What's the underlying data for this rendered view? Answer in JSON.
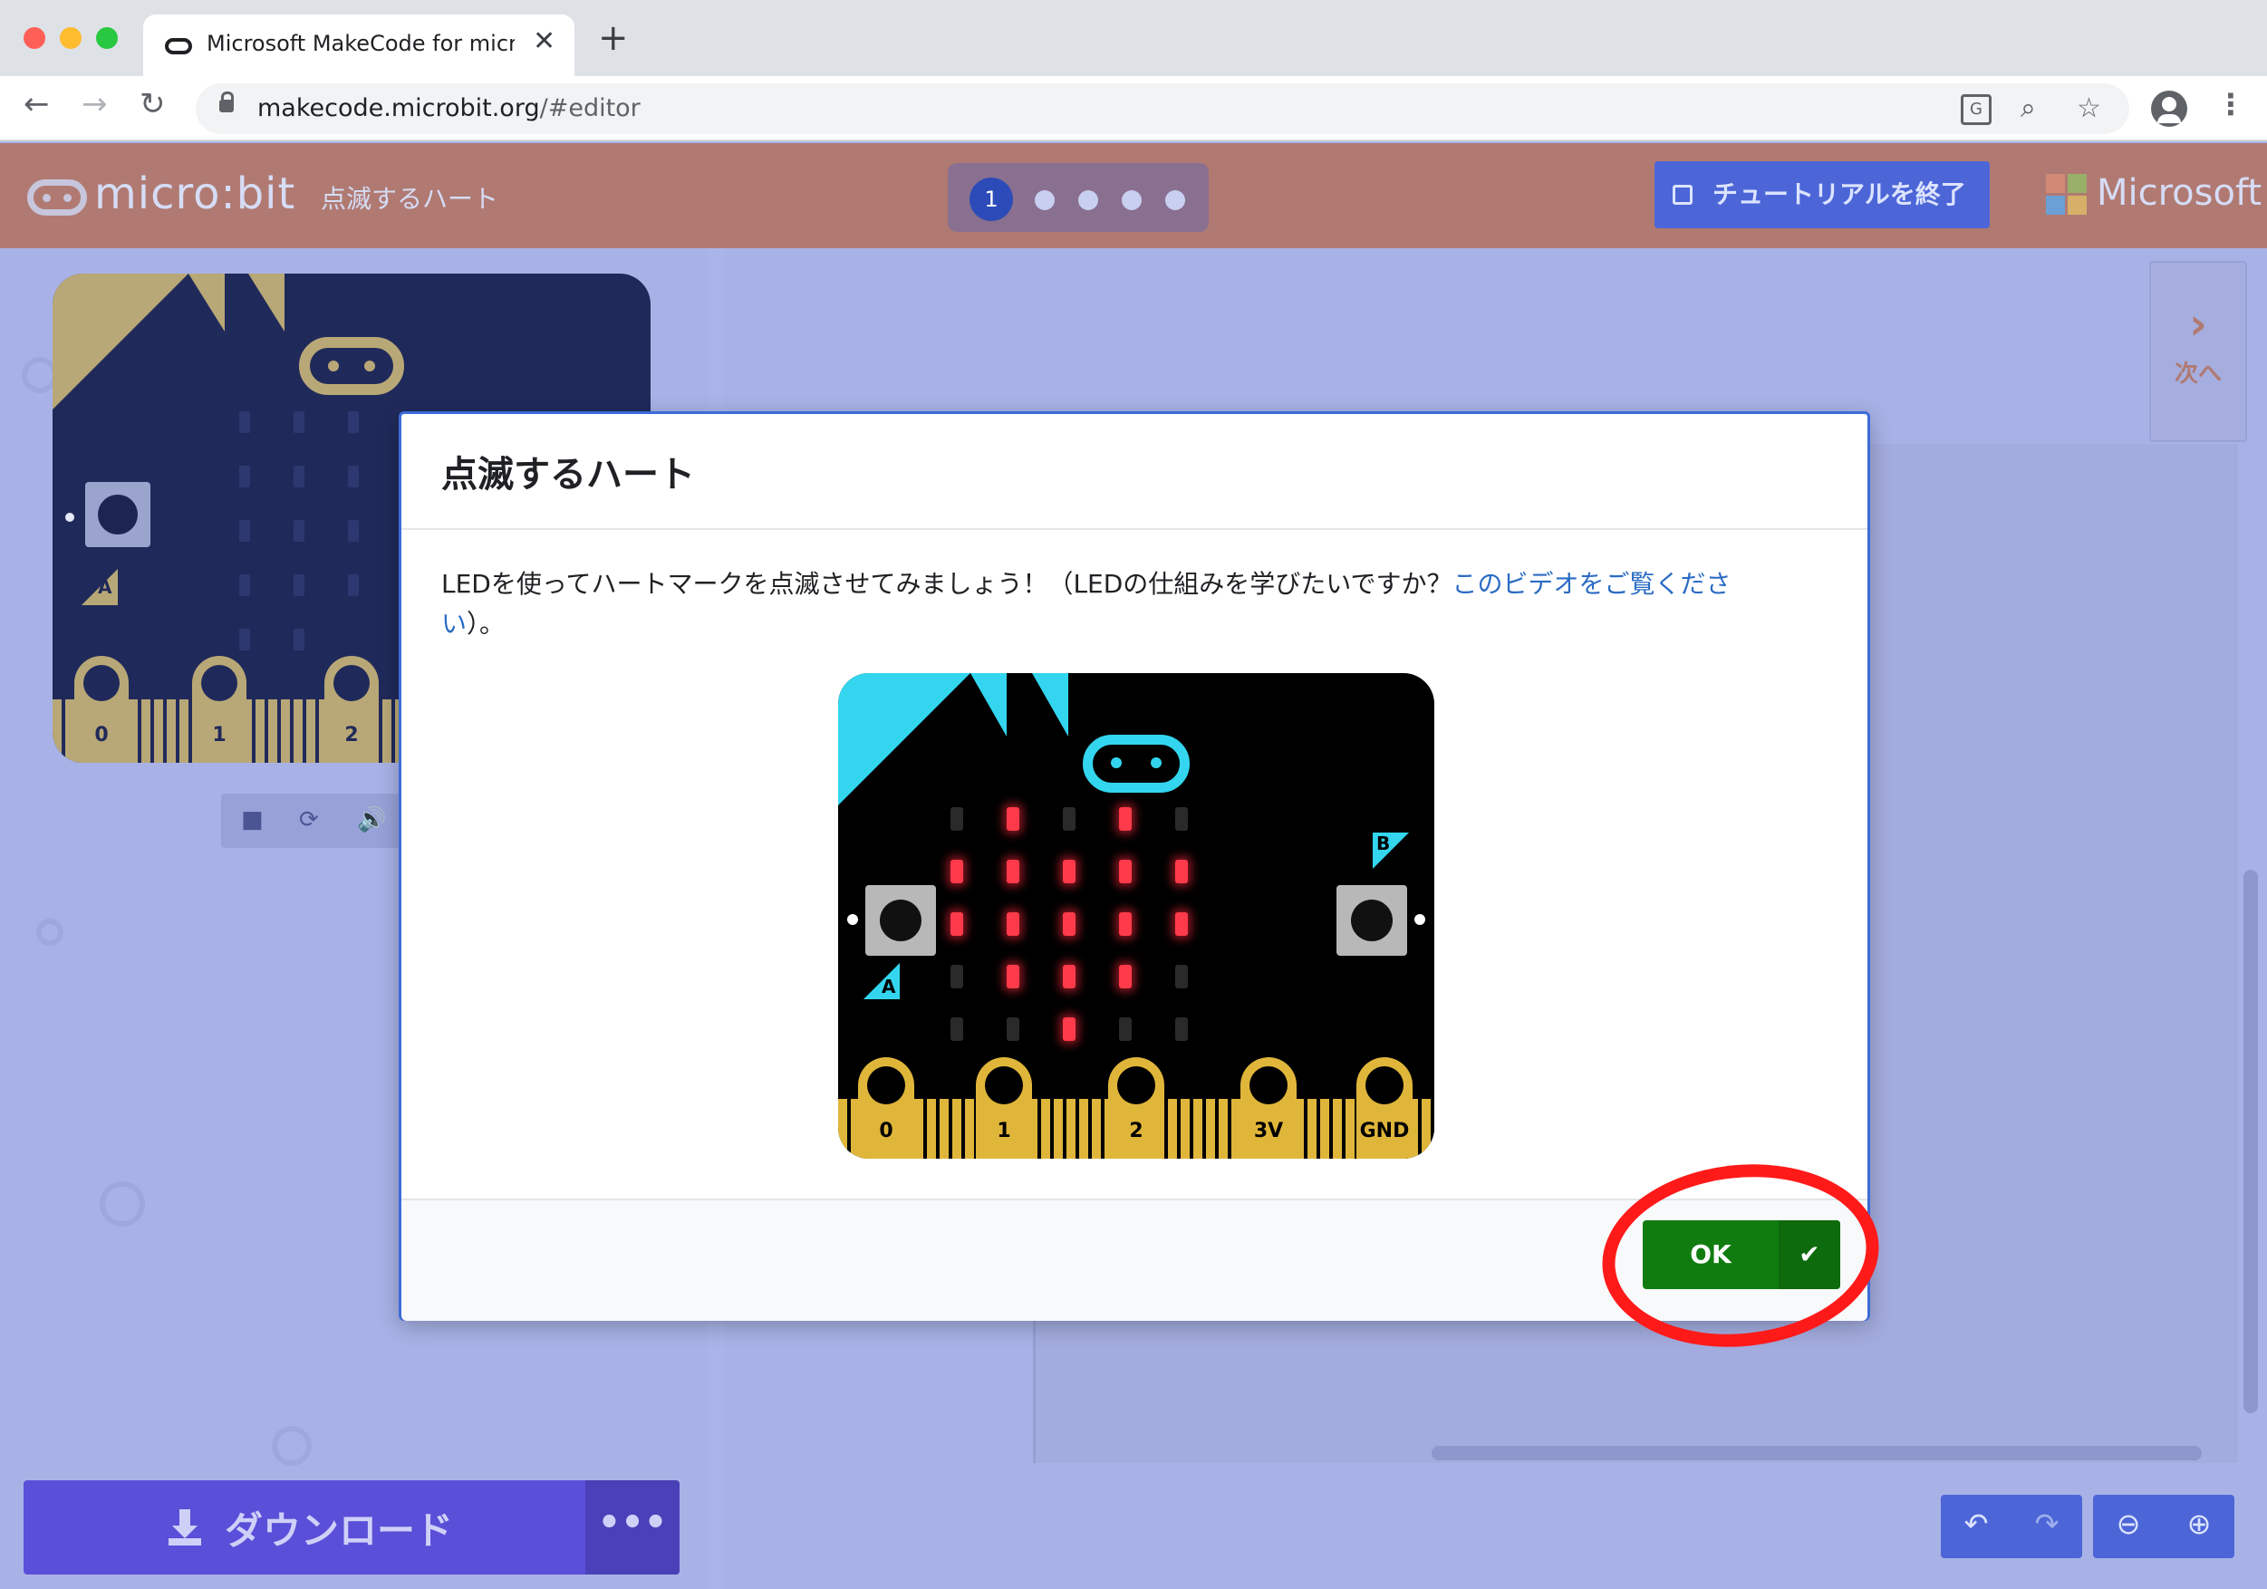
{
  "browser": {
    "tab_title": "Microsoft MakeCode for micro:bit",
    "tab_close": "✕",
    "new_tab": "+",
    "url_host": "makecode.microbit.org",
    "url_path": "/#editor",
    "back": "←",
    "forward": "→",
    "reload": "↻",
    "translate_glyph": "G",
    "zoom_glyph": "⌕",
    "star_glyph": "☆",
    "menu_glyph": "⋮"
  },
  "header": {
    "logo_text": "micro:bit",
    "project_title": "点滅するハート",
    "current_step": "1",
    "total_steps": 5,
    "exit_tutorial_label": "チュートリアルを終了",
    "brand_text": "Microsoft",
    "brand_colors": [
      "#f25022",
      "#7fba00",
      "#00a4ef",
      "#ffb900"
    ]
  },
  "simulator": {
    "pins": [
      "0",
      "1",
      "2"
    ],
    "button_a_label": "A",
    "stop_glyph": "■",
    "restart_glyph": "⟳",
    "sound_glyph": "🔊"
  },
  "side": {
    "next_chevron": "›",
    "next_label": "次へ"
  },
  "bottom": {
    "download_label": "ダウンロード",
    "more_label": "•••",
    "undo_glyph": "↶",
    "redo_glyph": "↷",
    "zoom_out_glyph": "⊖",
    "zoom_in_glyph": "⊕"
  },
  "modal": {
    "title": "点滅するハート",
    "text_before": "LEDを使ってハートマークを点滅させてみましょう！（LEDの仕組みを学びたいですか？",
    "link_text": "このビデオをご覧ください",
    "text_after": "）。",
    "ok_label": "OK",
    "ok_check": "✔",
    "illustration": {
      "pins": [
        "0",
        "1",
        "2",
        "3V",
        "GND"
      ],
      "button_a_label": "A",
      "button_b_label": "B",
      "led_rows": [
        [
          0,
          1,
          0,
          1,
          0
        ],
        [
          1,
          1,
          1,
          1,
          1
        ],
        [
          1,
          1,
          1,
          1,
          1
        ],
        [
          0,
          1,
          1,
          1,
          0
        ],
        [
          0,
          0,
          1,
          0,
          0
        ]
      ]
    }
  }
}
